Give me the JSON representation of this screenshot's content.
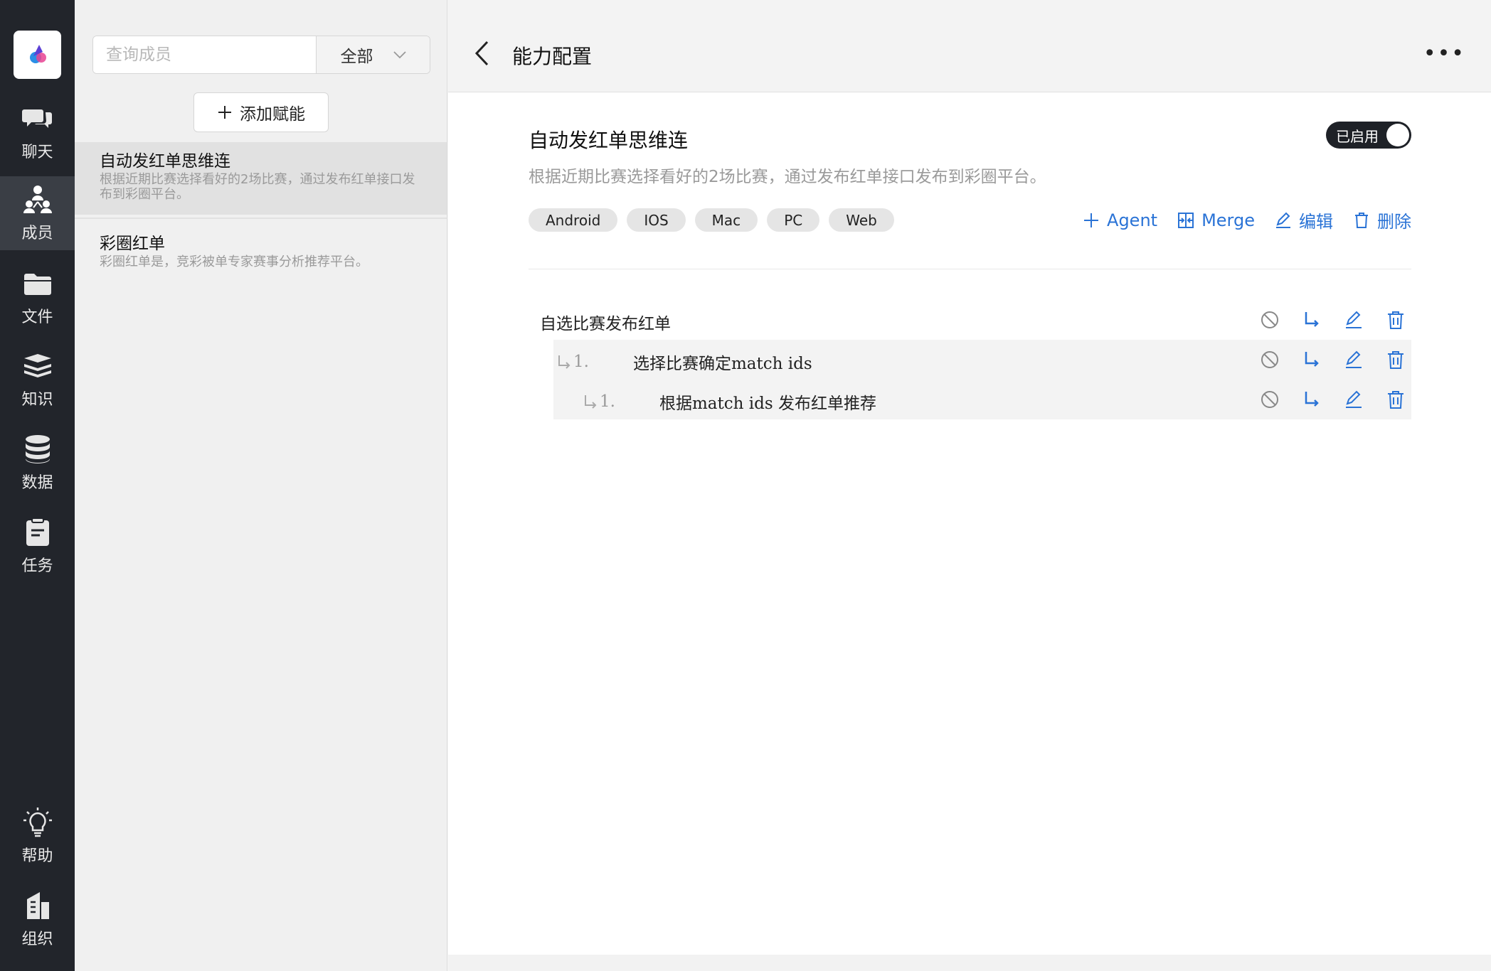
{
  "nav": {
    "items": [
      {
        "label": "聊天",
        "icon": "chat-icon"
      },
      {
        "label": "成员",
        "icon": "members-icon"
      },
      {
        "label": "文件",
        "icon": "folder-icon"
      },
      {
        "label": "知识",
        "icon": "books-icon"
      },
      {
        "label": "数据",
        "icon": "database-icon"
      },
      {
        "label": "任务",
        "icon": "clipboard-icon"
      },
      {
        "label": "帮助",
        "icon": "lightbulb-icon"
      },
      {
        "label": "组织",
        "icon": "building-icon"
      }
    ],
    "active": "成员"
  },
  "panel": {
    "search_placeholder": "查询成员",
    "filter_value": "全部",
    "add_label": "添加赋能",
    "members": [
      {
        "name": "自动发红单思维连",
        "desc": "根据近期比赛选择看好的2场比赛，通过发布红单接口发布到彩圈平台。"
      },
      {
        "name": "彩圈红单",
        "desc": "彩圈红单是，竞彩被单专家赛事分析推荐平台。"
      }
    ]
  },
  "header": {
    "title": "能力配置"
  },
  "capability": {
    "title": "自动发红单思维连",
    "toggle_label": "已启用",
    "description": "根据近期比赛选择看好的2场比赛，通过发布红单接口发布到彩圈平台。",
    "tags": [
      "Android",
      "IOS",
      "Mac",
      "PC",
      "Web"
    ],
    "actions": {
      "agent": "Agent",
      "merge": "Merge",
      "edit": "编辑",
      "delete": "删除"
    }
  },
  "steps": [
    {
      "index": "",
      "text": "自选比赛发布红单"
    },
    {
      "index": "1.",
      "text": "选择比赛确定match ids"
    },
    {
      "index": "1.",
      "text": "根据match ids 发布红单推荐"
    }
  ],
  "colors": {
    "accent": "#2a73d6",
    "nav_bg": "#22252b"
  }
}
